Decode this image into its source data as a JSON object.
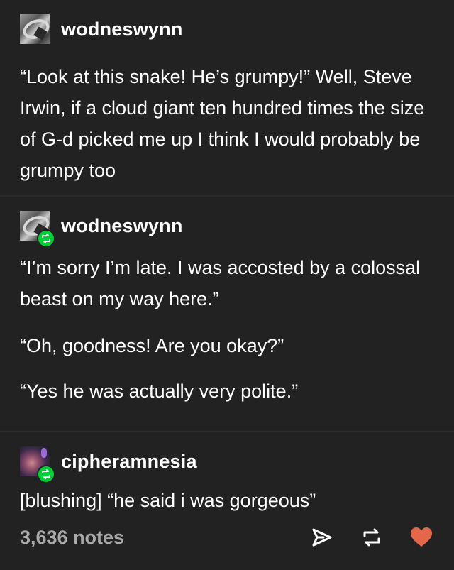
{
  "posts": [
    {
      "username": "wodneswynn",
      "avatar": "snake-avatar",
      "reblogged": false,
      "paragraphs": [
        "“Look at this snake!  He’s grumpy!”  Well, Steve Irwin, if a cloud giant ten hundred times the size of G-d picked me up I think I would probably be grumpy too"
      ]
    },
    {
      "username": "wodneswynn",
      "avatar": "snake-avatar",
      "reblogged": true,
      "paragraphs": [
        "“I’m sorry I’m late.  I was accosted by a colossal beast on my way here.”",
        "“Oh, goodness!  Are you okay?”",
        "“Yes he was actually very polite.”"
      ]
    },
    {
      "username": "cipheramnesia",
      "avatar": "person-avatar",
      "reblogged": true,
      "paragraphs": [
        "[blushing] “he said i was gorgeous”"
      ]
    }
  ],
  "footer": {
    "notes": "3,636 notes",
    "icons": [
      "share-icon",
      "reblog-icon",
      "like-icon"
    ],
    "like_color": "#e4674a",
    "notes_color": "#a9a9a9"
  },
  "colors": {
    "background": "#222222",
    "reblog_badge": "#00cf35",
    "text": "#ffffff"
  }
}
